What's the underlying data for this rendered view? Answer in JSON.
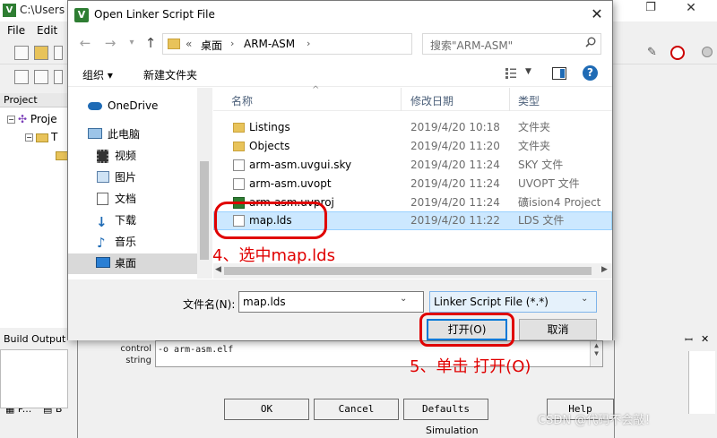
{
  "ide": {
    "title": "C:\\Users",
    "menu": [
      "File",
      "Edit"
    ],
    "project_header": "Project",
    "tree": [
      "Proje",
      "T"
    ],
    "proj_tabs": [
      "P...",
      "B"
    ],
    "build_output": "Build Output"
  },
  "options_dialog": {
    "control_label": "control\nstring",
    "control_value": "-o arm-asm.elf",
    "buttons": [
      "OK",
      "Cancel",
      "Defaults",
      "Help"
    ],
    "simulation": "Simulation"
  },
  "dialog": {
    "title": "Open Linker Script File",
    "address": {
      "prefix": "«",
      "crumbs": [
        "桌面",
        "ARM-ASM"
      ]
    },
    "search_placeholder": "搜索\"ARM-ASM\"",
    "organize": "组织 ▾",
    "new_folder": "新建文件夹",
    "sidebar": [
      {
        "label": "OneDrive",
        "icon": "cloud-icon"
      },
      {
        "label": "此电脑",
        "icon": "computer-icon"
      },
      {
        "label": "视频",
        "icon": "video-icon"
      },
      {
        "label": "图片",
        "icon": "picture-icon"
      },
      {
        "label": "文档",
        "icon": "document-icon"
      },
      {
        "label": "下载",
        "icon": "download-icon"
      },
      {
        "label": "音乐",
        "icon": "music-icon"
      },
      {
        "label": "桌面",
        "icon": "desktop-icon",
        "selected": true
      }
    ],
    "columns": [
      "名称",
      "修改日期",
      "类型"
    ],
    "files": [
      {
        "name": "Listings",
        "date": "2019/4/20 10:18",
        "type": "文件夹",
        "icon": "folder-icon"
      },
      {
        "name": "Objects",
        "date": "2019/4/20 11:20",
        "type": "文件夹",
        "icon": "folder-icon"
      },
      {
        "name": "arm-asm.uvgui.sky",
        "date": "2019/4/20 11:24",
        "type": "SKY 文件",
        "icon": "file-icon"
      },
      {
        "name": "arm-asm.uvopt",
        "date": "2019/4/20 11:24",
        "type": "UVOPT 文件",
        "icon": "file-icon"
      },
      {
        "name": "arm-asm.uvproj",
        "date": "2019/4/20 11:24",
        "type": "礦ision4 Project",
        "icon": "keil-project-icon"
      },
      {
        "name": "map.lds",
        "date": "2019/4/20 11:22",
        "type": "LDS 文件",
        "icon": "file-icon",
        "selected": true
      }
    ],
    "filename_label": "文件名(N):",
    "filename_value": "map.lds",
    "filetype": "Linker Script File (*.*)",
    "open": "打开(O)",
    "cancel": "取消"
  },
  "annotations": {
    "step4": "4、选中map.lds",
    "step5": "5、单击 打开(O)",
    "color": "#e00000"
  },
  "watermark": "CSDN @代码不会敲！"
}
